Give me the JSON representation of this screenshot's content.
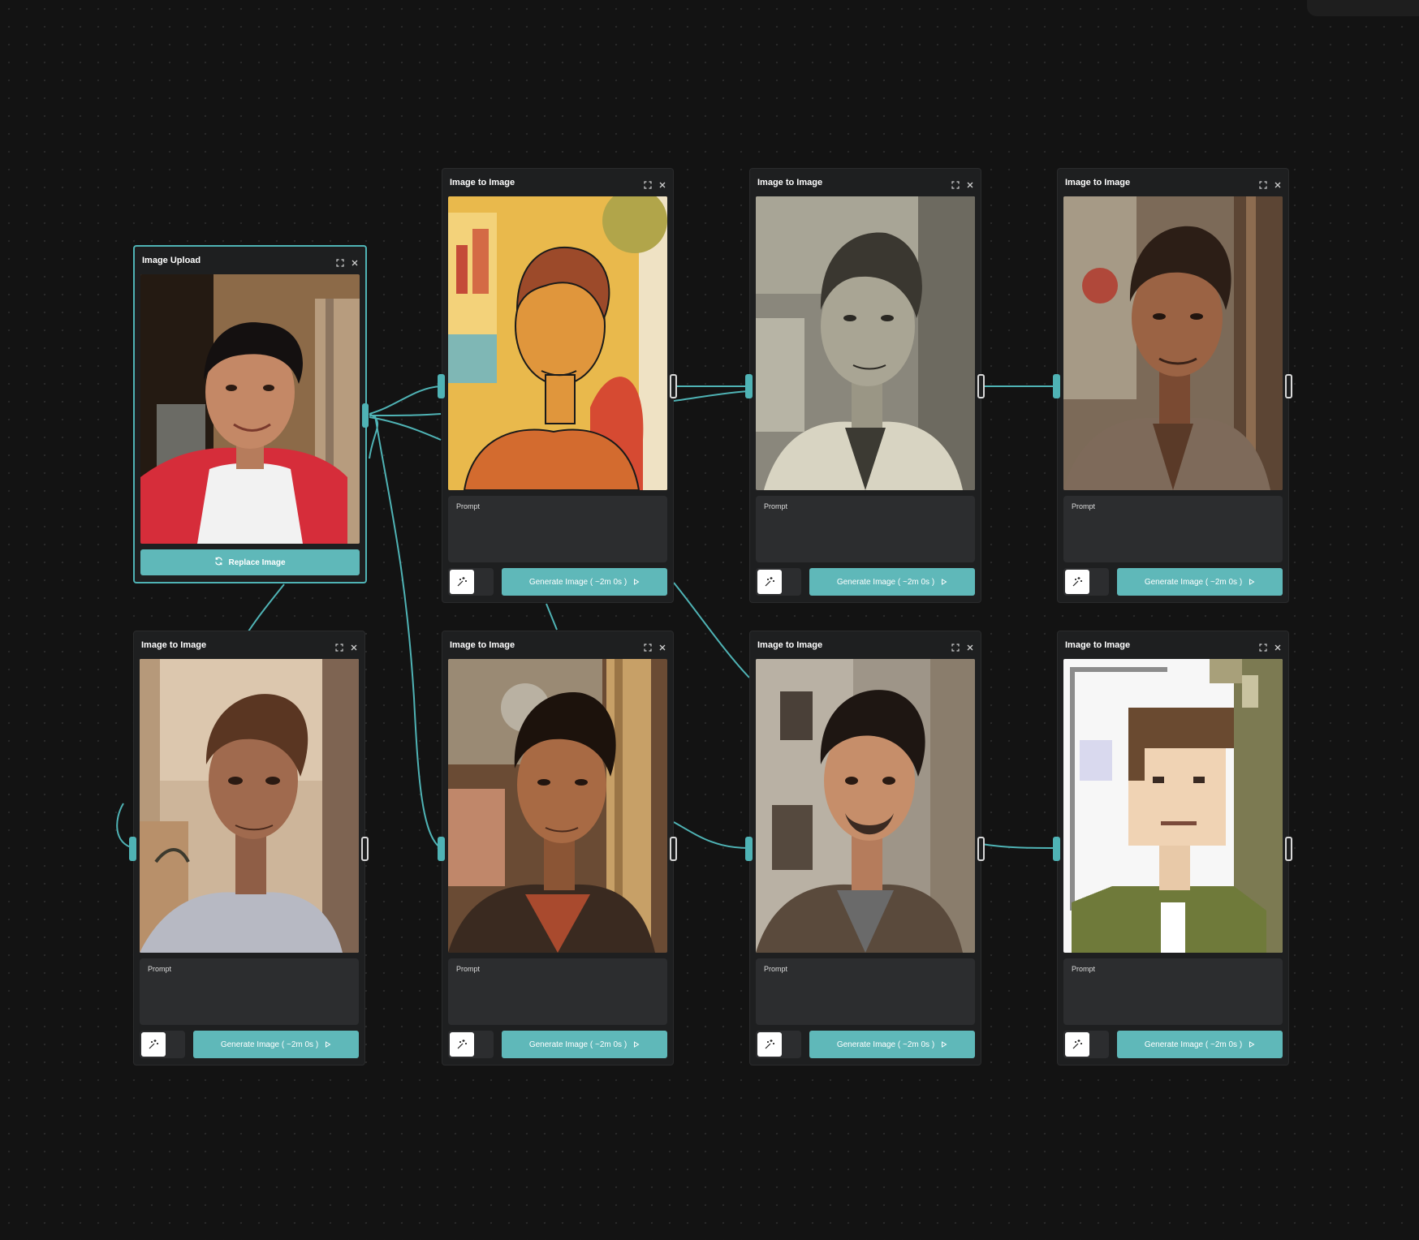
{
  "colors": {
    "accent": "#5fb8b9",
    "edge": "#4fb3b5",
    "node_bg": "#1e1f20",
    "prompt_bg": "#2c2d2f",
    "canvas_bg": "#131313"
  },
  "upload_node": {
    "title": "Image Upload",
    "replace_label": "Replace Image",
    "icons": [
      "expand-icon",
      "close-icon",
      "refresh-icon"
    ]
  },
  "nodes": [
    {
      "title": "Image to Image",
      "prompt_label": "Prompt",
      "generate_label": "Generate Image ( ~2m 0s )",
      "style": "comic"
    },
    {
      "title": "Image to Image",
      "prompt_label": "Prompt",
      "generate_label": "Generate Image ( ~2m 0s )",
      "style": "etching"
    },
    {
      "title": "Image to Image",
      "prompt_label": "Prompt",
      "generate_label": "Generate Image ( ~2m 0s )",
      "style": "painterly"
    },
    {
      "title": "Image to Image",
      "prompt_label": "Prompt",
      "generate_label": "Generate Image ( ~2m 0s )",
      "style": "anime"
    },
    {
      "title": "Image to Image",
      "prompt_label": "Prompt",
      "generate_label": "Generate Image ( ~2m 0s )",
      "style": "oil-painting"
    },
    {
      "title": "Image to Image",
      "prompt_label": "Prompt",
      "generate_label": "Generate Image ( ~2m 0s )",
      "style": "3d-render"
    },
    {
      "title": "Image to Image",
      "prompt_label": "Prompt",
      "generate_label": "Generate Image ( ~2m 0s )",
      "style": "pixel-art"
    }
  ]
}
